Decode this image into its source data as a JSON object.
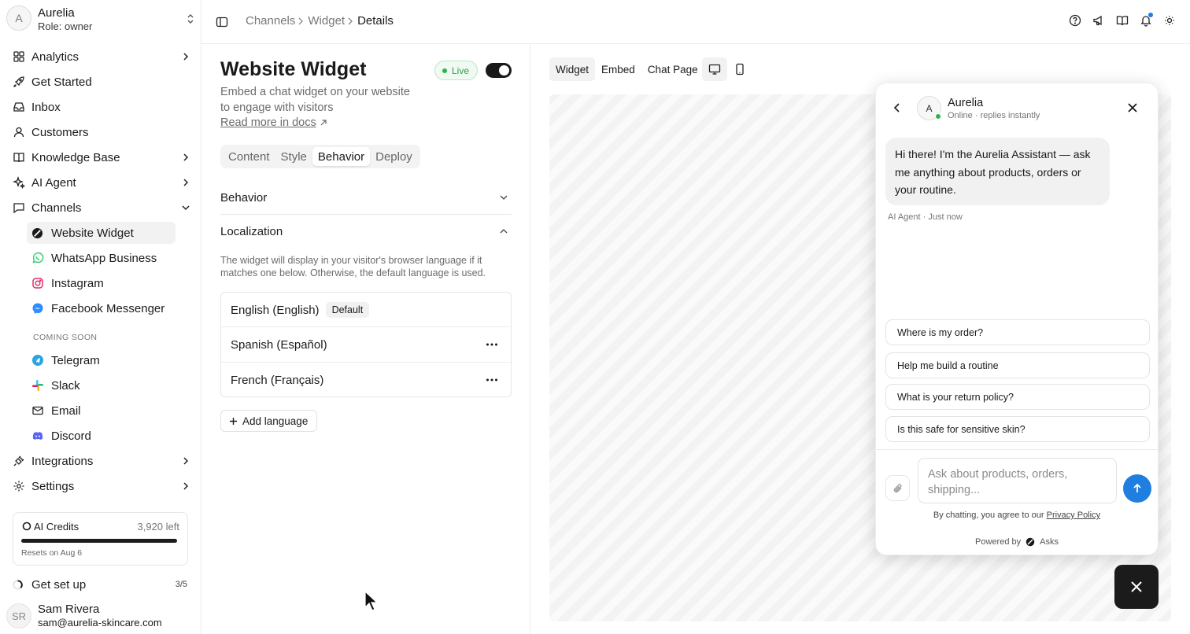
{
  "workspace": {
    "avatar": "A",
    "name": "Aurelia",
    "role": "Role: owner"
  },
  "nav": {
    "analytics": "Analytics",
    "get_started": "Get Started",
    "inbox": "Inbox",
    "customers": "Customers",
    "knowledge_base": "Knowledge Base",
    "ai_agent": "AI Agent",
    "channels": "Channels",
    "channel_items": [
      "Website Widget",
      "WhatsApp Business",
      "Instagram",
      "Facebook Messenger"
    ],
    "coming_soon": "COMING SOON",
    "soon_items": [
      "Telegram",
      "Slack",
      "Email",
      "Discord"
    ],
    "integrations": "Integrations",
    "settings": "Settings"
  },
  "credits": {
    "label": "AI Credits",
    "left": "3,920 left",
    "reset": "Resets on Aug 6"
  },
  "setup": {
    "label": "Get set up",
    "count": "3/5"
  },
  "user": {
    "initials": "SR",
    "name": "Sam Rivera",
    "email": "sam@aurelia-skincare.com"
  },
  "breadcrumb": [
    "Channels",
    "Widget",
    "Details"
  ],
  "panel": {
    "title": "Website Widget",
    "status": "Live",
    "description": "Embed a chat widget on your website to engage with visitors",
    "read_more": "Read more in docs",
    "tabs": [
      "Content",
      "Style",
      "Behavior",
      "Deploy"
    ],
    "active_tab": "Behavior",
    "behavior_heading": "Behavior",
    "localization_heading": "Localization",
    "localization_desc": "The widget will display in your visitor's browser language if it matches one below. Otherwise, the default language is used.",
    "languages": [
      {
        "name": "English (English)",
        "badge": "Default"
      },
      {
        "name": "Spanish (Español)"
      },
      {
        "name": "French (Français)"
      }
    ],
    "add_language": "Add language"
  },
  "preview": {
    "tabs": [
      "Widget",
      "Embed",
      "Chat Page"
    ],
    "active_tab": "Widget",
    "device": "desktop"
  },
  "chat": {
    "avatar": "A",
    "name": "Aurelia",
    "status": "Online · replies instantly",
    "message": "Hi there! I'm the Aurelia Assistant — ask me anything about products, orders or your routine.",
    "meta": "AI Agent · Just now",
    "suggestions": [
      "Where is my order?",
      "Help me build a routine",
      "What is your return policy?",
      "Is this safe for sensitive skin?"
    ],
    "input_placeholder": "Ask about products, orders, shipping...",
    "agree_prefix": "By chatting, you agree to our ",
    "agree_link": "Privacy Policy",
    "powered_by": "Powered by",
    "brand": "Asks",
    "send_color": "#1e7fe0"
  }
}
